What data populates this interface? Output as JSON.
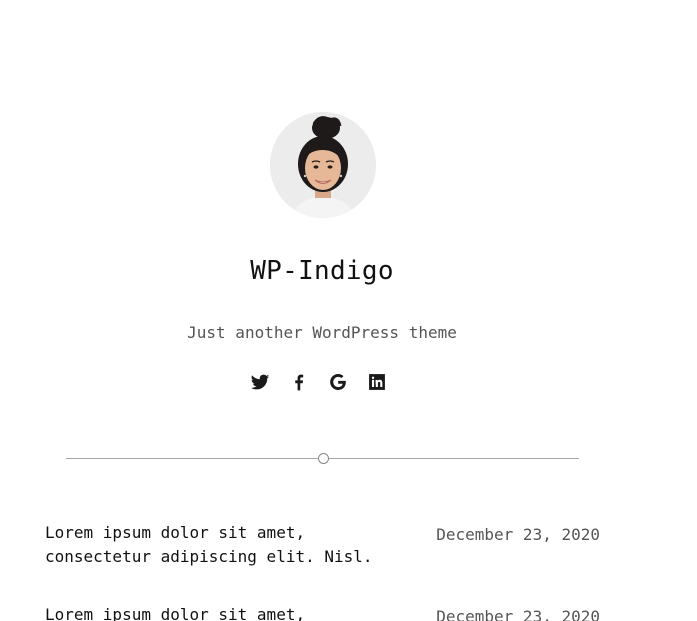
{
  "header": {
    "site_title": "WP-Indigo",
    "tagline": "Just another WordPress theme"
  },
  "social": {
    "items": [
      {
        "name": "twitter-icon"
      },
      {
        "name": "facebook-icon"
      },
      {
        "name": "google-icon"
      },
      {
        "name": "linkedin-icon"
      }
    ]
  },
  "posts": [
    {
      "title": "Lorem ipsum dolor sit amet, consectetur adipiscing elit. Nisl.",
      "date": "December 23, 2020"
    },
    {
      "title": "Lorem ipsum dolor sit amet,",
      "date": "December 23, 2020"
    }
  ]
}
